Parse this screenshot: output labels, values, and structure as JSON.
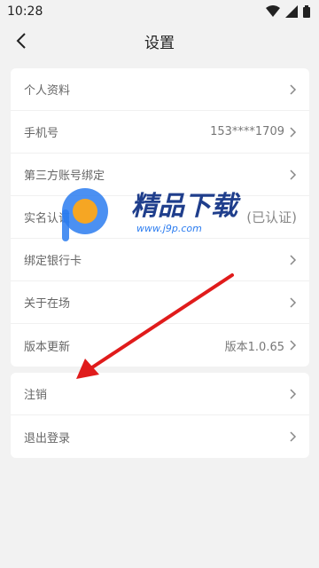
{
  "status": {
    "time": "10:28"
  },
  "header": {
    "title": "设置"
  },
  "settings_main": [
    {
      "label": "个人资料",
      "value": ""
    },
    {
      "label": "手机号",
      "value": "153****1709"
    },
    {
      "label": "第三方账号绑定",
      "value": ""
    },
    {
      "label": "实名认证",
      "value": "(已认证)"
    },
    {
      "label": "绑定银行卡",
      "value": ""
    },
    {
      "label": "关于在场",
      "value": ""
    },
    {
      "label": "版本更新",
      "value": "版本1.0.65"
    }
  ],
  "settings_account": [
    {
      "label": "注销"
    },
    {
      "label": "退出登录"
    }
  ],
  "watermark": {
    "title": "精品下载",
    "url": "www.j9p.com"
  },
  "colors": {
    "arrow": "#e01b1b",
    "accent_blue": "#2b7cf0",
    "accent_orange": "#f6a623"
  }
}
